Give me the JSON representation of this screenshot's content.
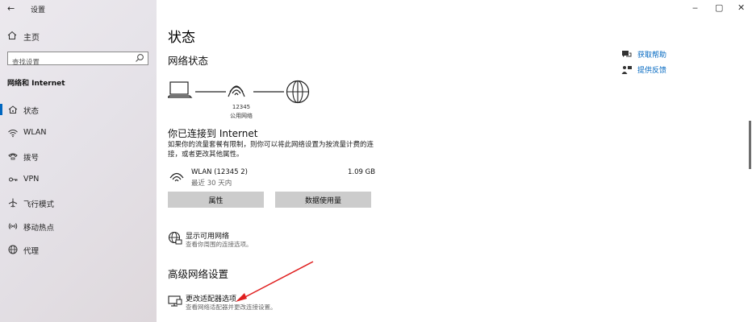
{
  "window": {
    "title": "设置",
    "back_glyph": "←",
    "minimize_glyph": "‒",
    "maximize_glyph": "▢",
    "close_glyph": "✕"
  },
  "sidebar": {
    "home_label": "主页",
    "search_placeholder": "查找设置",
    "section_title": "网络和 Internet",
    "items": [
      {
        "label": "状态",
        "icon": "home-network-icon",
        "active": true
      },
      {
        "label": "WLAN",
        "icon": "wifi-icon",
        "active": false
      },
      {
        "label": "拨号",
        "icon": "phone-icon",
        "active": false
      },
      {
        "label": "VPN",
        "icon": "vpn-icon",
        "active": false
      },
      {
        "label": "飞行模式",
        "icon": "airplane-icon",
        "active": false
      },
      {
        "label": "移动热点",
        "icon": "hotspot-icon",
        "active": false
      },
      {
        "label": "代理",
        "icon": "globe-icon",
        "active": false
      }
    ]
  },
  "main": {
    "page_title": "状态",
    "network_status_heading": "网络状态",
    "diagram": {
      "network_name": "12345",
      "network_type": "公用网络"
    },
    "connected_heading": "你已连接到 Internet",
    "connected_desc": "如果你的流量套餐有限制，则你可以将此网络设置为按流量计费的连接，或者更改其他属性。",
    "connection": {
      "name": "WLAN (12345 2)",
      "usage": "最近 30 天内",
      "size": "1.09 GB"
    },
    "buttons": {
      "properties": "属性",
      "data_usage": "数据使用量"
    },
    "show_networks": {
      "title": "显示可用网络",
      "subtitle": "查看你周围的连接选项。"
    },
    "advanced_heading": "高级网络设置",
    "adapter_options": {
      "title": "更改适配器选项",
      "subtitle": "查看网络适配器并更改连接设置。"
    }
  },
  "help_links": {
    "get_help": "获取帮助",
    "feedback": "提供反馈"
  },
  "colors": {
    "accent": "#0067c0",
    "annotation_arrow": "#e02020",
    "button_bg": "#cccccc"
  }
}
